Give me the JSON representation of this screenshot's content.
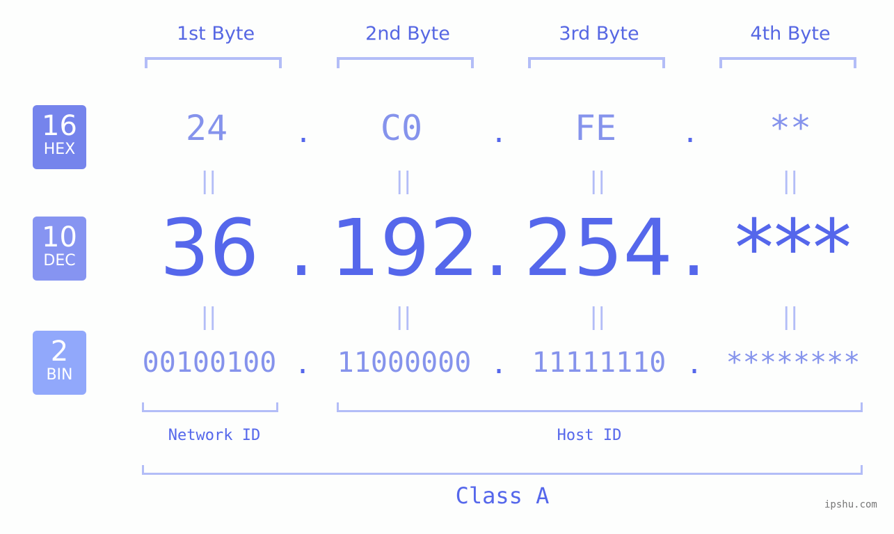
{
  "headers": [
    "1st Byte",
    "2nd Byte",
    "3rd Byte",
    "4th Byte"
  ],
  "bases": [
    {
      "num": "16",
      "label": "HEX",
      "color": "#7584ec"
    },
    {
      "num": "10",
      "label": "DEC",
      "color": "#8694f1"
    },
    {
      "num": "2",
      "label": "BIN",
      "color": "#91a8fb"
    }
  ],
  "hex": [
    "24",
    "C0",
    "FE",
    "**"
  ],
  "dec": [
    "36",
    "192",
    "254",
    "***"
  ],
  "bin": [
    "00100100",
    "11000000",
    "11111110",
    "********"
  ],
  "separator": ".",
  "equals": "||",
  "network_id_label": "Network ID",
  "host_id_label": "Host ID",
  "class_label": "Class A",
  "watermark": "ipshu.com",
  "colors": {
    "accent": "#5567eb",
    "light": "#8593ec",
    "bracket": "#b3bdf7"
  }
}
